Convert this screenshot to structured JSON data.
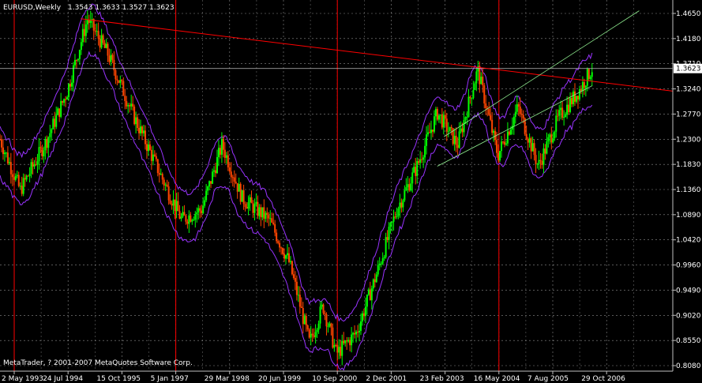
{
  "header": {
    "symbol": "EURUSD,Weekly",
    "ohlc": "1.3543 1.3633 1.3527 1.3623"
  },
  "footer": {
    "copyright": "MetaTrader, ? 2001-2007 MetaQuotes Software Corp."
  },
  "colors": {
    "background": "#000000",
    "grid": "#ffffff",
    "bull_candle": "#00ff00",
    "bear_candle": "#ff4500",
    "bands": "#9933ff",
    "trendline": "#ff0000",
    "channel": "#90ee90",
    "current_price_line": "#c0c0c0",
    "vertical_markers": "#ff0000",
    "price_tag_bg": "#ffffff",
    "price_tag_text": "#000000"
  },
  "chart_data": {
    "type": "candlestick",
    "title": "EURUSD,Weekly",
    "current_price": "1.3623",
    "ylim": [
      0.808,
      1.465
    ],
    "yticks": [
      "1.4650",
      "1.4180",
      "1.3710",
      "1.3240",
      "1.2770",
      "1.2300",
      "1.1830",
      "1.1360",
      "1.0890",
      "1.0420",
      "0.9960",
      "0.9490",
      "0.9020",
      "0.8550",
      "0.8080"
    ],
    "xticks": [
      "2 May 1993",
      "24 Jul 1994",
      "15 Oct 1995",
      "5 Jan 1997",
      "29 Mar 1998",
      "20 Jun 1999",
      "10 Sep 2000",
      "2 Dec 2001",
      "23 Feb 2003",
      "16 May 2004",
      "7 Aug 2005",
      "29 Oct 2006"
    ],
    "price_path": [
      [
        0,
        1.23
      ],
      [
        0.03,
        1.135
      ],
      [
        0.07,
        1.23
      ],
      [
        0.1,
        1.32
      ],
      [
        0.13,
        1.455
      ],
      [
        0.16,
        1.39
      ],
      [
        0.2,
        1.27
      ],
      [
        0.24,
        1.16
      ],
      [
        0.27,
        1.08
      ],
      [
        0.3,
        1.1
      ],
      [
        0.33,
        1.22
      ],
      [
        0.36,
        1.12
      ],
      [
        0.4,
        1.08
      ],
      [
        0.43,
        1.0
      ],
      [
        0.46,
        0.85
      ],
      [
        0.48,
        0.92
      ],
      [
        0.5,
        0.83
      ],
      [
        0.53,
        0.87
      ],
      [
        0.56,
        0.98
      ],
      [
        0.59,
        1.1
      ],
      [
        0.62,
        1.18
      ],
      [
        0.65,
        1.28
      ],
      [
        0.68,
        1.22
      ],
      [
        0.71,
        1.36
      ],
      [
        0.74,
        1.2
      ],
      [
        0.77,
        1.29
      ],
      [
        0.8,
        1.18
      ],
      [
        0.83,
        1.27
      ],
      [
        0.86,
        1.32
      ],
      [
        0.88,
        1.362
      ]
    ],
    "band_offset": 0.045,
    "red_trendline": [
      [
        0.12,
        1.455
      ],
      [
        1.0,
        1.32
      ]
    ],
    "channel_lower": [
      [
        0.65,
        1.18
      ],
      [
        0.88,
        1.33
      ]
    ],
    "channel_upper": [
      [
        0.66,
        1.235
      ],
      [
        0.95,
        1.47
      ]
    ],
    "vertical_markers_x": [
      "2 May 1993",
      "5 Jan 1997",
      "10 Sep 2000",
      "16 May 2004"
    ]
  }
}
